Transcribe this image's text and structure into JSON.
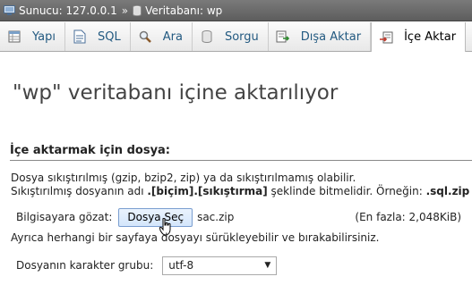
{
  "breadcrumb": {
    "server": "Sunucu: 127.0.0.1",
    "separator": "»",
    "database": "Veritabanı: wp"
  },
  "tabs": [
    {
      "label": "Yapı",
      "icon": "structure-icon"
    },
    {
      "label": "SQL",
      "icon": "sql-icon"
    },
    {
      "label": "Ara",
      "icon": "search-icon"
    },
    {
      "label": "Sorgu",
      "icon": "query-icon"
    },
    {
      "label": "Dışa Aktar",
      "icon": "export-icon"
    },
    {
      "label": "İçe Aktar",
      "icon": "import-icon",
      "active": true
    }
  ],
  "main": {
    "title": "\"wp\" veritabanı içine aktarılıyor",
    "section_title": "İçe aktarmak için dosya:",
    "line1": "Dosya sıkıştırılmış (gzip, bzip2, zip) ya da sıkıştırılmamış olabilir.",
    "line2_pre": "Sıkıştırılmış dosyanın adı ",
    "line2_bold": ".[biçim].[sıkıştırma]",
    "line2_mid": " şeklinde bitmelidir. Örneğin: ",
    "line2_example": ".sql.zip",
    "browse_label": "Bilgisayara gözat:",
    "file_button": "Dosya Seç",
    "file_name": "sac.zip",
    "max_size": "(En fazla: 2,048KiB)",
    "drag_note": "Ayrıca herhangi bir sayfaya dosyayı sürükleyebilir ve bırakabilirsiniz.",
    "charset_label": "Dosyanın karakter grubu:",
    "charset_value": "utf-8"
  },
  "colors": {
    "tab_link": "#235a81",
    "breadcrumb_bg": "#6b6b6b"
  }
}
